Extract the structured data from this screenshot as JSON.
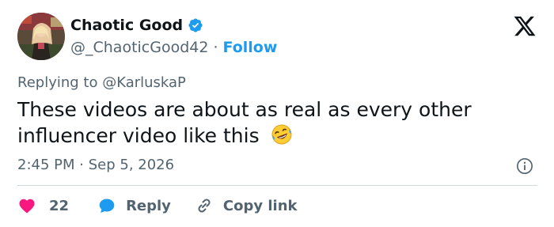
{
  "author": {
    "display_name": "Chaotic Good",
    "handle": "@_ChaoticGood42",
    "separator": "·",
    "follow_label": "Follow",
    "verified_color": "#1d9bf0"
  },
  "reply": {
    "prefix": "Replying to",
    "mention": "@KarluskaP"
  },
  "tweet": {
    "text": "These videos are about as real as every other influencer video like this",
    "emoji_icon": "rolling-on-floor-laughing-emoji"
  },
  "meta": {
    "time": "2:45 PM",
    "separator": "·",
    "date": "Sep 5, 2026"
  },
  "actions": {
    "like_count": "22",
    "reply_label": "Reply",
    "copy_link_label": "Copy link"
  },
  "icons": {
    "logo": "x-logo-icon",
    "info": "info-icon",
    "like": "heart-icon",
    "reply": "reply-bubble-icon",
    "copy": "link-icon"
  },
  "colors": {
    "text": "#0f1419",
    "secondary": "#536471",
    "accent": "#1d9bf0",
    "like": "#f91880",
    "divider": "#cfd9de"
  }
}
